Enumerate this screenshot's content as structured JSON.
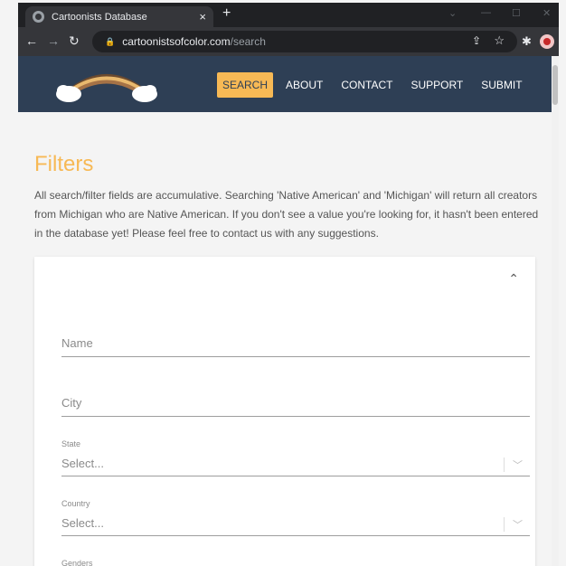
{
  "browser": {
    "tab_title": "Cartoonists Database",
    "tab_close": "×",
    "new_tab": "+",
    "url_host": "cartoonistsofcolor.com",
    "url_path": "/search"
  },
  "nav": {
    "items": [
      {
        "label": "SEARCH",
        "active": true
      },
      {
        "label": "ABOUT",
        "active": false
      },
      {
        "label": "CONTACT",
        "active": false
      },
      {
        "label": "SUPPORT",
        "active": false
      },
      {
        "label": "SUBMIT",
        "active": false
      }
    ]
  },
  "colors": {
    "header_bg": "#2e3f55",
    "accent": "#f7b955"
  },
  "filters": {
    "title": "Filters",
    "intro": "All search/filter fields are accumulative. Searching 'Native American' and 'Michigan' will return all creators from Michigan who are Native American. If you don't see a value you're looking for, it hasn't been entered in the database yet! Please feel free to contact us with any suggestions.",
    "name_placeholder": "Name",
    "city_placeholder": "City",
    "state_label": "State",
    "state_value": "Select...",
    "country_label": "Country",
    "country_value": "Select...",
    "genders_label": "Genders"
  }
}
